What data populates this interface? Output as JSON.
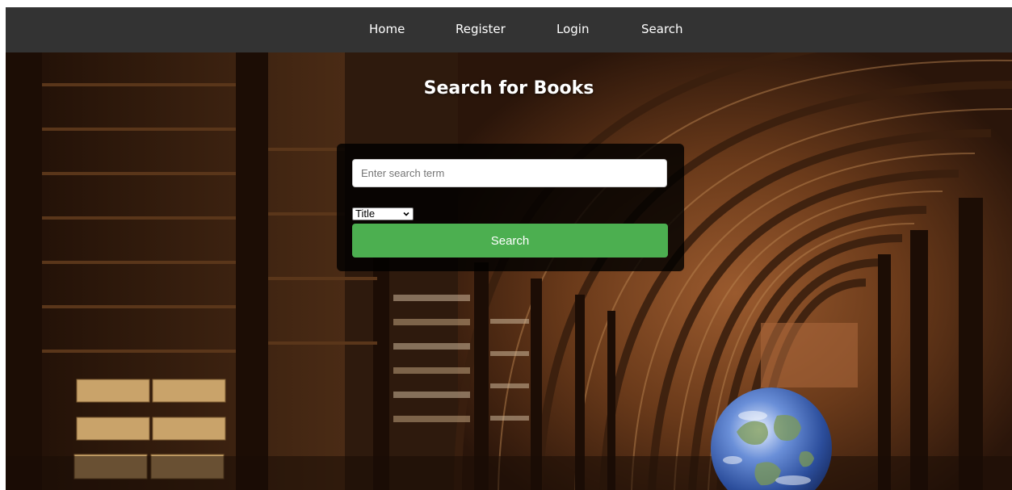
{
  "nav": {
    "items": [
      {
        "label": "Home"
      },
      {
        "label": "Register"
      },
      {
        "label": "Login"
      },
      {
        "label": "Search"
      }
    ]
  },
  "hero": {
    "title": "Search for Books"
  },
  "search": {
    "placeholder": "Enter search term",
    "value": "",
    "field_selected": "Title",
    "button_label": "Search"
  },
  "colors": {
    "navbar_bg": "#333333",
    "button_green": "#4caf50",
    "panel_bg": "rgba(0,0,0,0.82)"
  }
}
